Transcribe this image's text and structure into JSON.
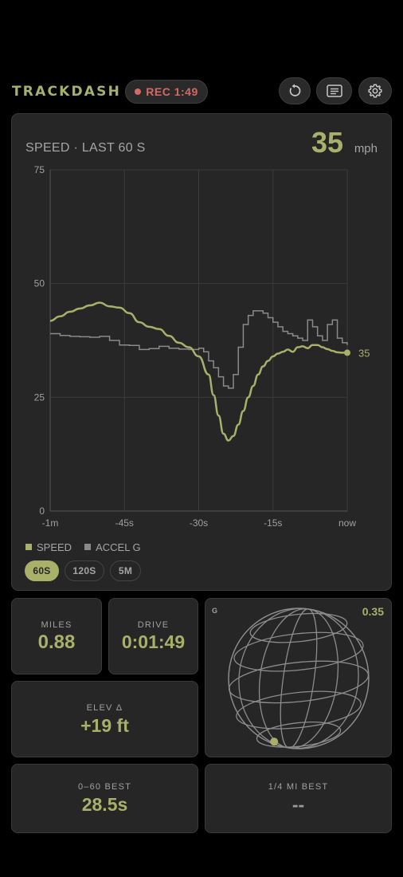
{
  "header": {
    "brand": "TRACKDASH",
    "rec_label": "REC 1:49",
    "buttons": [
      "reset-icon",
      "log-icon",
      "gear-icon"
    ]
  },
  "chart": {
    "title": "SPEED · LAST 60 S",
    "current_value": "35",
    "unit": "mph",
    "end_label": "35",
    "legend": [
      "SPEED",
      "ACCEL G"
    ],
    "ranges": [
      {
        "label": "60S",
        "active": true
      },
      {
        "label": "120S",
        "active": false
      },
      {
        "label": "5M",
        "active": false
      }
    ]
  },
  "chart_data": {
    "type": "line",
    "title": "SPEED · LAST 60 S",
    "xlabel": "",
    "ylabel": "",
    "ylim": [
      0,
      75
    ],
    "xlim": [
      -60,
      0
    ],
    "yticks": [
      0,
      25,
      50,
      75
    ],
    "xticks": [
      {
        "v": -60,
        "label": "-1m"
      },
      {
        "v": -45,
        "label": "-45s"
      },
      {
        "v": -30,
        "label": "-30s"
      },
      {
        "v": -15,
        "label": "-15s"
      },
      {
        "v": 0,
        "label": "now"
      }
    ],
    "grid": true,
    "legend_position": "bottom-left",
    "series": [
      {
        "name": "SPEED",
        "color": "#a9b06a",
        "x": [
          -60,
          -58,
          -56,
          -54,
          -52,
          -50,
          -48,
          -46,
          -44,
          -42,
          -40,
          -38,
          -36,
          -34,
          -32,
          -30,
          -28,
          -27,
          -26,
          -25,
          -24,
          -23,
          -22,
          -21,
          -20,
          -19,
          -18,
          -17,
          -16,
          -15,
          -14,
          -13,
          -12,
          -11,
          -10,
          -9,
          -8,
          -7,
          -6,
          -5,
          -4,
          -3,
          -2,
          -1,
          0
        ],
        "values": [
          41.8,
          42.8,
          43.8,
          44.5,
          45.2,
          45.8,
          45.0,
          44.7,
          43.5,
          41.5,
          40.5,
          40.0,
          38.5,
          37.0,
          36.0,
          34.0,
          30.0,
          25.5,
          21.0,
          17.0,
          15.5,
          16.5,
          19.0,
          22.0,
          25.0,
          27.5,
          30.0,
          31.8,
          33.0,
          34.0,
          34.6,
          35.0,
          35.5,
          35.0,
          36.0,
          36.2,
          35.8,
          36.5,
          36.5,
          36.0,
          35.6,
          35.2,
          34.9,
          34.8,
          34.8
        ]
      },
      {
        "name": "ACCEL G",
        "color": "#8a8a8a",
        "x": [
          -60,
          -58,
          -56,
          -54,
          -52,
          -50,
          -48,
          -46,
          -44,
          -42,
          -40,
          -38,
          -36,
          -34,
          -32,
          -30,
          -29,
          -28,
          -27,
          -26,
          -25,
          -24,
          -23,
          -22,
          -21,
          -20,
          -19,
          -18,
          -17,
          -16,
          -15,
          -14,
          -13,
          -12,
          -11,
          -10,
          -9,
          -8,
          -7,
          -6,
          -5,
          -4,
          -3,
          -2,
          -1,
          0
        ],
        "values": [
          39.0,
          38.6,
          38.4,
          38.3,
          38.2,
          38.4,
          37.5,
          36.5,
          36.4,
          35.5,
          35.7,
          36.2,
          35.8,
          35.6,
          35.5,
          35.8,
          35.0,
          33.0,
          31.5,
          29.5,
          27.5,
          27.0,
          30.0,
          36.0,
          41.0,
          43.0,
          44.0,
          44.0,
          43.5,
          42.5,
          41.5,
          40.5,
          39.5,
          39.0,
          38.5,
          38.0,
          37.5,
          42.0,
          40.5,
          38.5,
          37.5,
          41.0,
          42.0,
          38.0,
          37.0,
          36.5
        ]
      }
    ]
  },
  "tiles": {
    "miles": {
      "label": "MILES",
      "value": "0.88"
    },
    "drive": {
      "label": "DRIVE",
      "value": "0:01:49"
    },
    "elev": {
      "label": "ELEV Δ",
      "value": "+19 ft"
    },
    "zero60": {
      "label": "0–60 BEST",
      "value": "28.5s"
    },
    "quarter": {
      "label": "1/4 MI BEST",
      "value": "--"
    }
  },
  "gforce": {
    "label": "G",
    "value": "0.35",
    "dot": {
      "x": -0.35,
      "y": -0.9
    }
  },
  "colors": {
    "accent": "#a9b06a",
    "rec": "#d46a63",
    "series_secondary": "#8a8a8a",
    "card_bg": "#262626"
  }
}
